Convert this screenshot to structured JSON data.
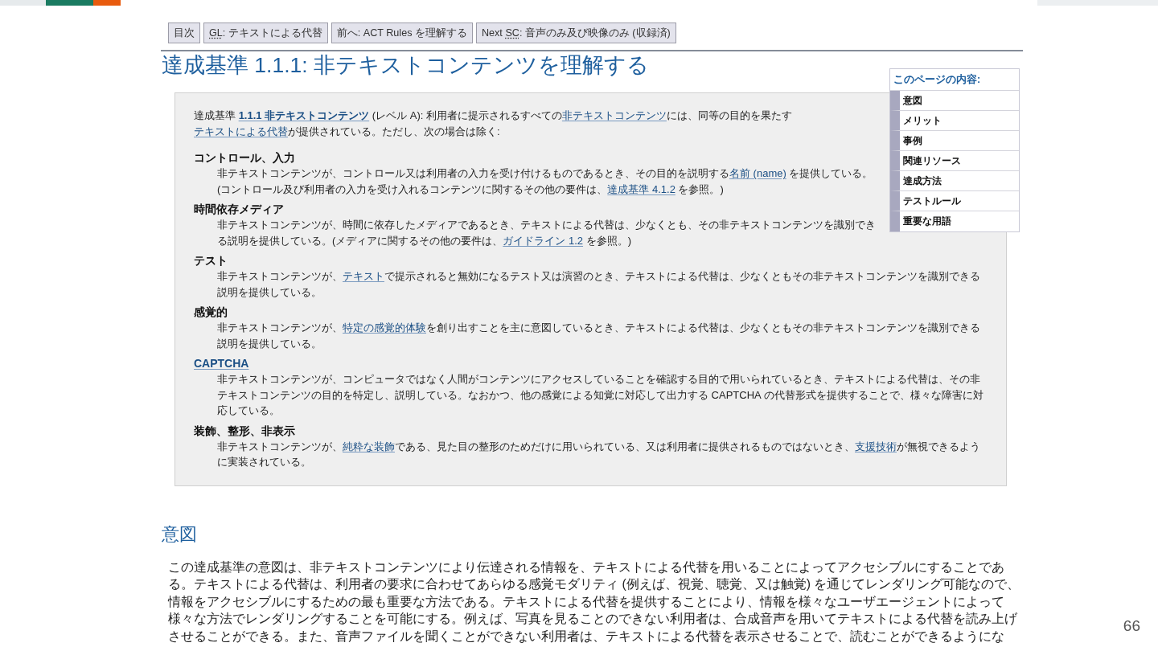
{
  "nav": [
    {
      "parts": [
        {
          "kind": "text",
          "text": "目次"
        }
      ]
    },
    {
      "parts": [
        {
          "kind": "abbr",
          "text": "GL"
        },
        {
          "kind": "text",
          "text": ": テキストによる代替"
        }
      ]
    },
    {
      "parts": [
        {
          "kind": "text",
          "text": "前へ: ACT Rules を理解する"
        }
      ]
    },
    {
      "parts": [
        {
          "kind": "text",
          "text": "Next "
        },
        {
          "kind": "abbr",
          "text": "SC"
        },
        {
          "kind": "text",
          "text": ": 音声のみ及び映像のみ (収録済)"
        }
      ]
    }
  ],
  "title": "達成基準 1.1.1: 非テキストコンテンツを理解する",
  "toc": {
    "heading": "このページの内容:",
    "items": [
      "意図",
      "メリット",
      "事例",
      "関連リソース",
      "達成方法",
      "テストルール",
      "重要な用語"
    ]
  },
  "criterion": {
    "intro": [
      {
        "kind": "text",
        "text": "達成基準 "
      },
      {
        "kind": "strong-link",
        "text": "1.1.1 非テキストコンテンツ"
      },
      {
        "kind": "text",
        "text": " (レベル A): 利用者に提示されるすべての"
      },
      {
        "kind": "link",
        "text": "非テキストコンテンツ"
      },
      {
        "kind": "text",
        "text": "には、同等の目的を果たす"
      },
      {
        "kind": "link",
        "text": "テキストによる代替"
      },
      {
        "kind": "text",
        "text": "が提供されている。ただし、次の場合は除く:"
      }
    ],
    "items": [
      {
        "term": "コントロール、入力",
        "term_link": false,
        "text": [
          {
            "kind": "text",
            "text": "非テキストコンテンツが、コントロール又は利用者の入力を受け付けるものであるとき、その目的を説明する"
          },
          {
            "kind": "link",
            "text": "名前 (name)"
          },
          {
            "kind": "text",
            "text": " を提供している。(コントロール及び利用者の入力を受け入れるコンテンツに関するその他の要件は、"
          },
          {
            "kind": "link",
            "text": "達成基準 4.1.2"
          },
          {
            "kind": "text",
            "text": " を参照。)"
          }
        ]
      },
      {
        "term": "時間依存メディア",
        "term_link": false,
        "text": [
          {
            "kind": "text",
            "text": "非テキストコンテンツが、時間に依存したメディアであるとき、テキストによる代替は、少なくとも、その非テキストコンテンツを識別できる説明を提供している。(メディアに関するその他の要件は、"
          },
          {
            "kind": "link",
            "text": "ガイドライン 1.2"
          },
          {
            "kind": "text",
            "text": " を参照。)"
          }
        ]
      },
      {
        "term": "テスト",
        "term_link": false,
        "text": [
          {
            "kind": "text",
            "text": "非テキストコンテンツが、"
          },
          {
            "kind": "link",
            "text": "テキスト"
          },
          {
            "kind": "text",
            "text": "で提示されると無効になるテスト又は演習のとき、テキストによる代替は、少なくともその非テキストコンテンツを識別できる説明を提供している。"
          }
        ]
      },
      {
        "term": "感覚的",
        "term_link": false,
        "text": [
          {
            "kind": "text",
            "text": "非テキストコンテンツが、"
          },
          {
            "kind": "link",
            "text": "特定の感覚的体験"
          },
          {
            "kind": "text",
            "text": "を創り出すことを主に意図しているとき、テキストによる代替は、少なくともその非テキストコンテンツを識別できる説明を提供している。"
          }
        ]
      },
      {
        "term": "CAPTCHA",
        "term_link": true,
        "text": [
          {
            "kind": "text",
            "text": "非テキストコンテンツが、コンピュータではなく人間がコンテンツにアクセスしていることを確認する目的で用いられているとき、テキストによる代替は、その非テキストコンテンツの目的を特定し、説明している。なおかつ、他の感覚による知覚に対応して出力する CAPTCHA の代替形式を提供することで、様々な障害に対応している。"
          }
        ]
      },
      {
        "term": "装飾、整形、非表示",
        "term_link": false,
        "text": [
          {
            "kind": "text",
            "text": "非テキストコンテンツが、"
          },
          {
            "kind": "link",
            "text": "純粋な装飾"
          },
          {
            "kind": "text",
            "text": "である、見た目の整形のためだけに用いられている、又は利用者に提供されるものではないとき、"
          },
          {
            "kind": "link",
            "text": "支援技術"
          },
          {
            "kind": "text",
            "text": "が無視できるように実装されている。"
          }
        ]
      }
    ]
  },
  "intent": {
    "heading": "意図",
    "paragraph": "この達成基準の意図は、非テキストコンテンツにより伝達される情報を、テキストによる代替を用いることによってアクセシブルにすることである。テキストによる代替は、利用者の要求に合わせてあらゆる感覚モダリティ (例えば、視覚、聴覚、又は触覚) を通じてレンダリング可能なので、情報をアクセシブルにするための最も重要な方法である。テキストによる代替を提供することにより、情報を様々なユーザエージェントによって様々な方法でレンダリングすることを可能にする。例えば、写真を見ることのできない利用者は、合成音声を用いてテキストによる代替を読み上げさせることができる。また、音声ファイルを聞くことができない利用者は、テキストによる代替を表示させることで、読むことができるようにな"
  },
  "slide": {
    "page_number": "66"
  }
}
